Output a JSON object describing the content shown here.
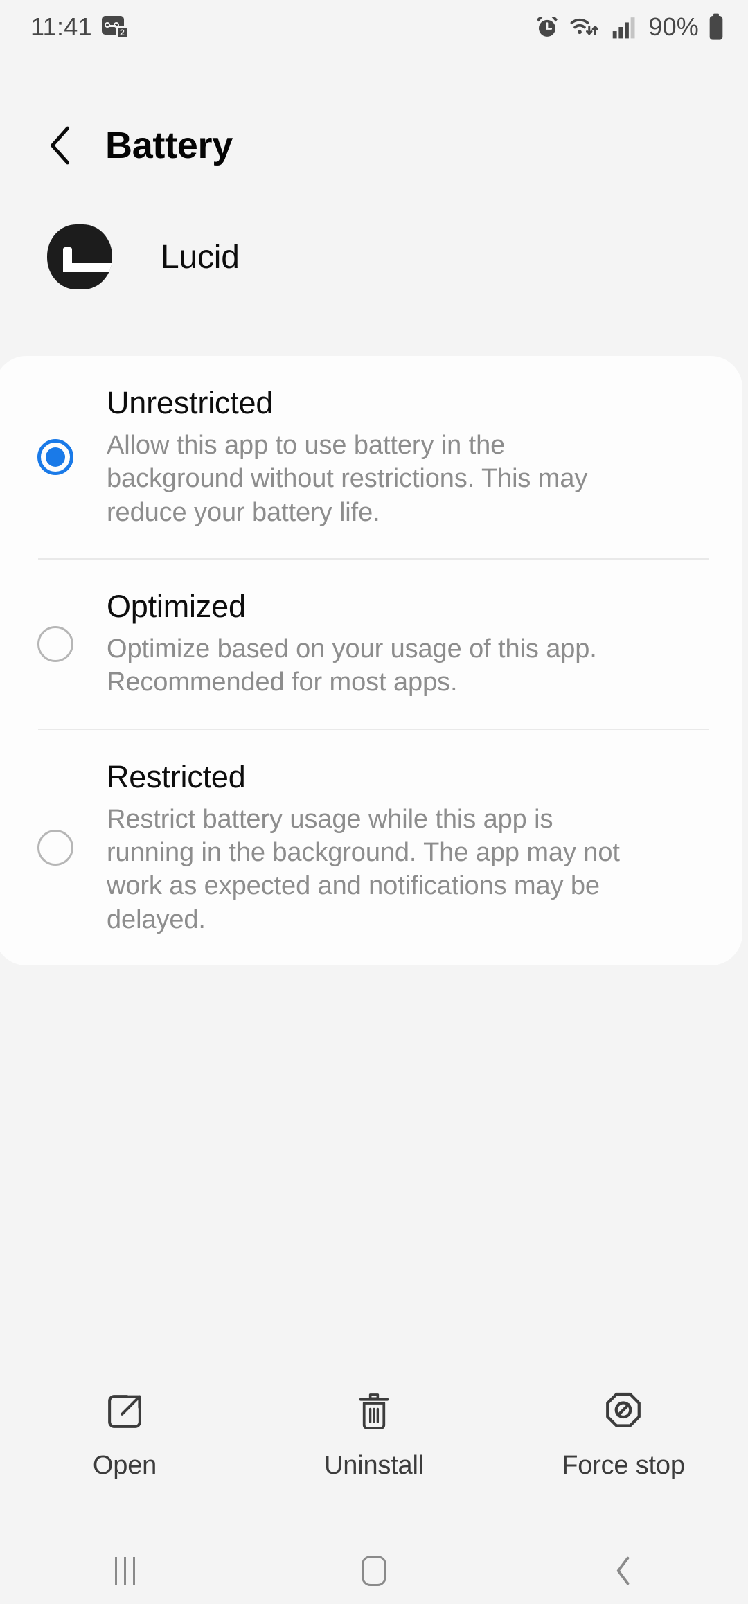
{
  "status_bar": {
    "time": "11:41",
    "voicemail_count": "2",
    "battery_percent": "90%",
    "icons": [
      "voicemail-icon",
      "alarm-icon",
      "wifi-icon",
      "cellular-signal-icon",
      "battery-icon"
    ]
  },
  "header": {
    "title": "Battery",
    "back_icon": "chevron-left-icon"
  },
  "app": {
    "name": "Lucid",
    "icon": "lucid-app-icon"
  },
  "options": [
    {
      "title": "Unrestricted",
      "description": "Allow this app to use battery in the background without restrictions. This may reduce your battery life.",
      "selected": true
    },
    {
      "title": "Optimized",
      "description": "Optimize based on your usage of this app. Recommended for most apps.",
      "selected": false
    },
    {
      "title": "Restricted",
      "description": "Restrict battery usage while this app is running in the background. The app may not work as expected and notifications may be delayed.",
      "selected": false
    }
  ],
  "actions": [
    {
      "label": "Open",
      "icon": "external-link-icon"
    },
    {
      "label": "Uninstall",
      "icon": "trash-icon"
    },
    {
      "label": "Force stop",
      "icon": "block-octagon-icon"
    }
  ],
  "nav_bar": [
    {
      "name": "recents",
      "icon": "recents-icon"
    },
    {
      "name": "home",
      "icon": "home-icon"
    },
    {
      "name": "back",
      "icon": "back-chevron-icon"
    }
  ],
  "colors": {
    "accent": "#1a7ae8",
    "background": "#f4f4f4",
    "card": "#fdfdfd",
    "title_text": "#0d0d0d",
    "secondary_text": "#8d8d8d"
  }
}
